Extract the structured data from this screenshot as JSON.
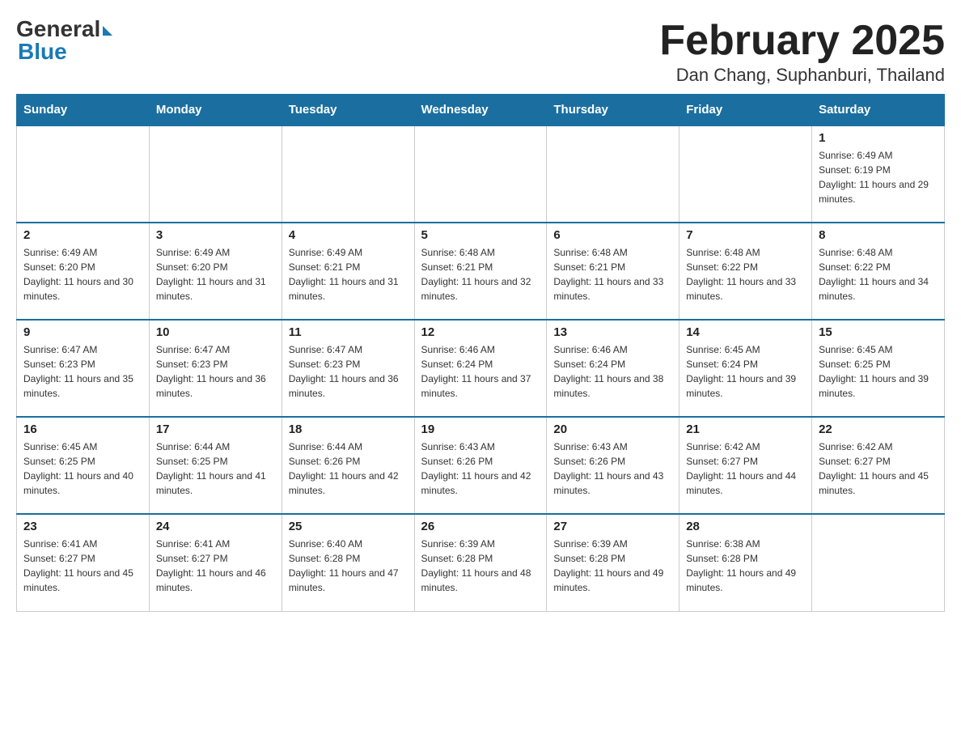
{
  "header": {
    "logo": {
      "general": "General",
      "blue": "Blue"
    },
    "title": "February 2025",
    "location": "Dan Chang, Suphanburi, Thailand"
  },
  "days_of_week": [
    "Sunday",
    "Monday",
    "Tuesday",
    "Wednesday",
    "Thursday",
    "Friday",
    "Saturday"
  ],
  "weeks": [
    [
      {
        "day": "",
        "info": ""
      },
      {
        "day": "",
        "info": ""
      },
      {
        "day": "",
        "info": ""
      },
      {
        "day": "",
        "info": ""
      },
      {
        "day": "",
        "info": ""
      },
      {
        "day": "",
        "info": ""
      },
      {
        "day": "1",
        "info": "Sunrise: 6:49 AM\nSunset: 6:19 PM\nDaylight: 11 hours and 29 minutes."
      }
    ],
    [
      {
        "day": "2",
        "info": "Sunrise: 6:49 AM\nSunset: 6:20 PM\nDaylight: 11 hours and 30 minutes."
      },
      {
        "day": "3",
        "info": "Sunrise: 6:49 AM\nSunset: 6:20 PM\nDaylight: 11 hours and 31 minutes."
      },
      {
        "day": "4",
        "info": "Sunrise: 6:49 AM\nSunset: 6:21 PM\nDaylight: 11 hours and 31 minutes."
      },
      {
        "day": "5",
        "info": "Sunrise: 6:48 AM\nSunset: 6:21 PM\nDaylight: 11 hours and 32 minutes."
      },
      {
        "day": "6",
        "info": "Sunrise: 6:48 AM\nSunset: 6:21 PM\nDaylight: 11 hours and 33 minutes."
      },
      {
        "day": "7",
        "info": "Sunrise: 6:48 AM\nSunset: 6:22 PM\nDaylight: 11 hours and 33 minutes."
      },
      {
        "day": "8",
        "info": "Sunrise: 6:48 AM\nSunset: 6:22 PM\nDaylight: 11 hours and 34 minutes."
      }
    ],
    [
      {
        "day": "9",
        "info": "Sunrise: 6:47 AM\nSunset: 6:23 PM\nDaylight: 11 hours and 35 minutes."
      },
      {
        "day": "10",
        "info": "Sunrise: 6:47 AM\nSunset: 6:23 PM\nDaylight: 11 hours and 36 minutes."
      },
      {
        "day": "11",
        "info": "Sunrise: 6:47 AM\nSunset: 6:23 PM\nDaylight: 11 hours and 36 minutes."
      },
      {
        "day": "12",
        "info": "Sunrise: 6:46 AM\nSunset: 6:24 PM\nDaylight: 11 hours and 37 minutes."
      },
      {
        "day": "13",
        "info": "Sunrise: 6:46 AM\nSunset: 6:24 PM\nDaylight: 11 hours and 38 minutes."
      },
      {
        "day": "14",
        "info": "Sunrise: 6:45 AM\nSunset: 6:24 PM\nDaylight: 11 hours and 39 minutes."
      },
      {
        "day": "15",
        "info": "Sunrise: 6:45 AM\nSunset: 6:25 PM\nDaylight: 11 hours and 39 minutes."
      }
    ],
    [
      {
        "day": "16",
        "info": "Sunrise: 6:45 AM\nSunset: 6:25 PM\nDaylight: 11 hours and 40 minutes."
      },
      {
        "day": "17",
        "info": "Sunrise: 6:44 AM\nSunset: 6:25 PM\nDaylight: 11 hours and 41 minutes."
      },
      {
        "day": "18",
        "info": "Sunrise: 6:44 AM\nSunset: 6:26 PM\nDaylight: 11 hours and 42 minutes."
      },
      {
        "day": "19",
        "info": "Sunrise: 6:43 AM\nSunset: 6:26 PM\nDaylight: 11 hours and 42 minutes."
      },
      {
        "day": "20",
        "info": "Sunrise: 6:43 AM\nSunset: 6:26 PM\nDaylight: 11 hours and 43 minutes."
      },
      {
        "day": "21",
        "info": "Sunrise: 6:42 AM\nSunset: 6:27 PM\nDaylight: 11 hours and 44 minutes."
      },
      {
        "day": "22",
        "info": "Sunrise: 6:42 AM\nSunset: 6:27 PM\nDaylight: 11 hours and 45 minutes."
      }
    ],
    [
      {
        "day": "23",
        "info": "Sunrise: 6:41 AM\nSunset: 6:27 PM\nDaylight: 11 hours and 45 minutes."
      },
      {
        "day": "24",
        "info": "Sunrise: 6:41 AM\nSunset: 6:27 PM\nDaylight: 11 hours and 46 minutes."
      },
      {
        "day": "25",
        "info": "Sunrise: 6:40 AM\nSunset: 6:28 PM\nDaylight: 11 hours and 47 minutes."
      },
      {
        "day": "26",
        "info": "Sunrise: 6:39 AM\nSunset: 6:28 PM\nDaylight: 11 hours and 48 minutes."
      },
      {
        "day": "27",
        "info": "Sunrise: 6:39 AM\nSunset: 6:28 PM\nDaylight: 11 hours and 49 minutes."
      },
      {
        "day": "28",
        "info": "Sunrise: 6:38 AM\nSunset: 6:28 PM\nDaylight: 11 hours and 49 minutes."
      },
      {
        "day": "",
        "info": ""
      }
    ]
  ]
}
